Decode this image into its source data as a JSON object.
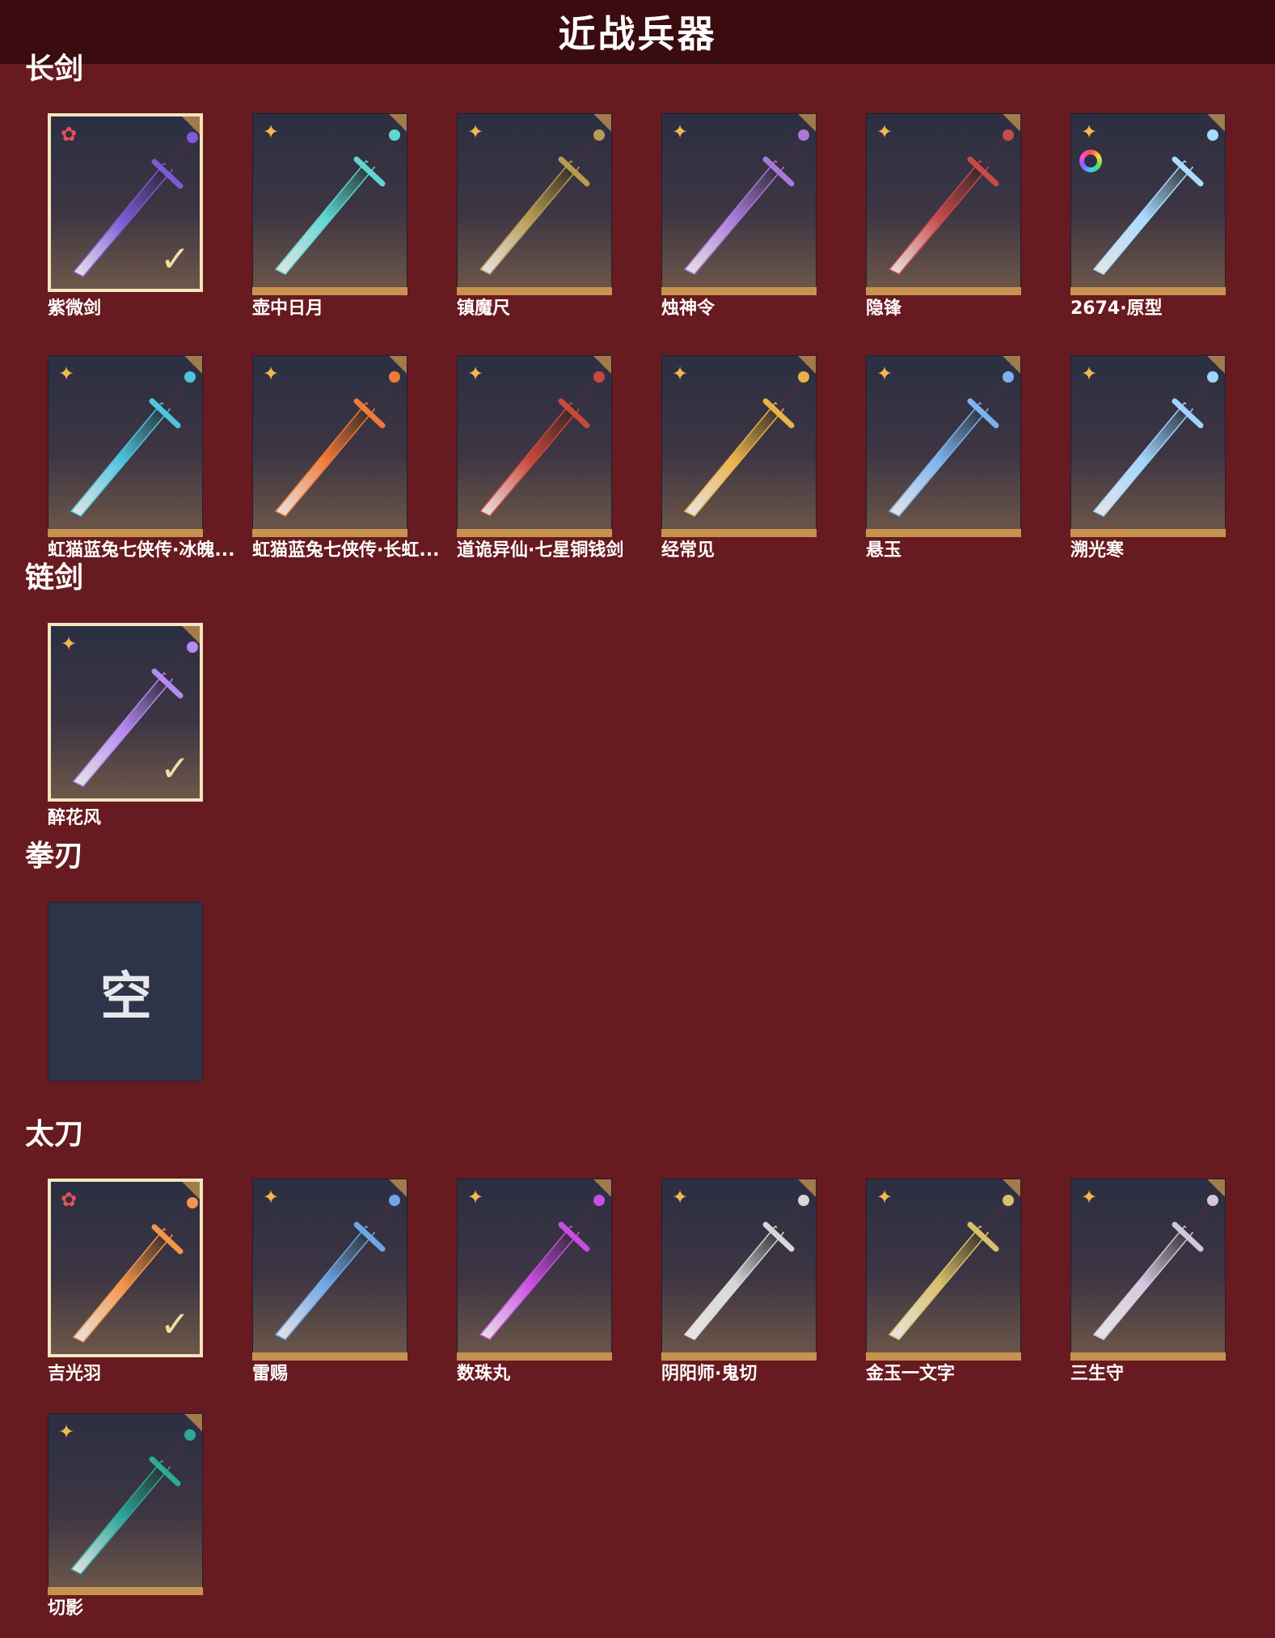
{
  "header": {
    "title": "近战兵器"
  },
  "sections": [
    {
      "title": "长剑",
      "items": [
        {
          "name": "紫微剑",
          "selected": true,
          "badge": "red",
          "color": "#7d5ad6"
        },
        {
          "name": "壶中日月",
          "selected": false,
          "badge": "gold",
          "color": "#5fd6cf"
        },
        {
          "name": "镇魔尺",
          "selected": false,
          "badge": "gold",
          "color": "#b89a52"
        },
        {
          "name": "烛神令",
          "selected": false,
          "badge": "gold",
          "color": "#a879d8"
        },
        {
          "name": "隐锋",
          "selected": false,
          "badge": "gold",
          "color": "#c84a4a"
        },
        {
          "name": "2674·原型",
          "selected": false,
          "badge": "gold",
          "color": "#a9dcff"
        },
        {
          "name": "虹猫蓝兔七侠传·冰魄...",
          "selected": false,
          "badge": "gold",
          "color": "#4fc4dd"
        },
        {
          "name": "虹猫蓝兔七侠传·长虹...",
          "selected": false,
          "badge": "gold",
          "color": "#f07a3a"
        },
        {
          "name": "道诡异仙·七星铜钱剑",
          "selected": false,
          "badge": "gold",
          "color": "#c8493b"
        },
        {
          "name": "经常见",
          "selected": false,
          "badge": "gold",
          "color": "#e8b24a"
        },
        {
          "name": "悬玉",
          "selected": false,
          "badge": "gold",
          "color": "#7db2ee"
        },
        {
          "name": "溯光寒",
          "selected": false,
          "badge": "gold",
          "color": "#9fd4ff"
        }
      ]
    },
    {
      "title": "链剑",
      "items": [
        {
          "name": "醉花风",
          "selected": true,
          "badge": "gold",
          "color": "#b58af2"
        }
      ]
    },
    {
      "title": "拳刃",
      "empty_label": "空"
    },
    {
      "title": "太刀",
      "items": [
        {
          "name": "吉光羽",
          "selected": true,
          "badge": "red",
          "color": "#f3954a"
        },
        {
          "name": "雷赐",
          "selected": false,
          "badge": "gold",
          "color": "#6fa7e6"
        },
        {
          "name": "数珠丸",
          "selected": false,
          "badge": "gold",
          "color": "#c94fe0"
        },
        {
          "name": "阴阳师·鬼切",
          "selected": false,
          "badge": "gold",
          "color": "#d7d7d7"
        },
        {
          "name": "金玉一文字",
          "selected": false,
          "badge": "gold",
          "color": "#d9c06a"
        },
        {
          "name": "三生守",
          "selected": false,
          "badge": "gold",
          "color": "#d3c7dd"
        },
        {
          "name": "切影",
          "selected": false,
          "badge": "gold",
          "color": "#2fa89a"
        }
      ]
    }
  ]
}
